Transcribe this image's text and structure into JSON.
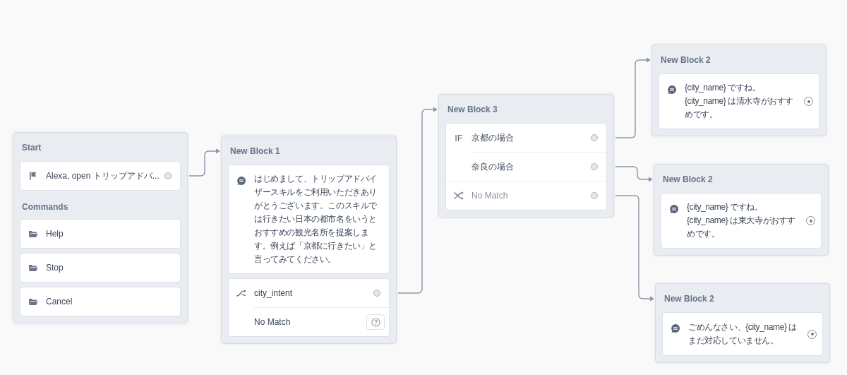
{
  "blocks": [
    {
      "title": "Start",
      "sections": [
        {
          "cards": [
            {
              "rows": [
                {
                  "kind": "trigger",
                  "text": "Alexa, open トリップアドバ..."
                }
              ]
            }
          ]
        },
        {
          "label": "Commands",
          "cards": [
            {
              "rows": [
                {
                  "kind": "command",
                  "text": "Help"
                }
              ]
            },
            {
              "rows": [
                {
                  "kind": "command",
                  "text": "Stop"
                }
              ]
            },
            {
              "rows": [
                {
                  "kind": "command",
                  "text": "Cancel"
                }
              ]
            }
          ]
        }
      ]
    },
    {
      "title": "New Block 1",
      "sections": [
        {
          "cards": [
            {
              "rows": [
                {
                  "kind": "speech",
                  "text": "はじめまして、トリップアドバイザースキルをご利用いただきありがとうございます。このスキルでは行きたい日本の都市名をいうとおすすめの観光名所を提案します。例えば「京都に行きたい」と言ってみてください。"
                }
              ]
            },
            {
              "rows": [
                {
                  "kind": "intent",
                  "text": "city_intent"
                },
                {
                  "kind": "unhandled",
                  "text": "No Match"
                }
              ]
            }
          ]
        }
      ]
    },
    {
      "title": "New Block 3",
      "sections": [
        {
          "cards": [
            {
              "rows": [
                {
                  "kind": "condition",
                  "prefix": "IF",
                  "text": "京都の場合"
                },
                {
                  "kind": "condition",
                  "text": "奈良の場合"
                },
                {
                  "kind": "fallback",
                  "text": "No Match"
                }
              ]
            }
          ]
        }
      ]
    },
    {
      "title": "New Block 2",
      "sections": [
        {
          "cards": [
            {
              "rows": [
                {
                  "kind": "reply",
                  "text": "{city_name} ですね。\n{city_name} は清水寺がおすすめです。"
                }
              ]
            }
          ]
        }
      ]
    },
    {
      "title": "New Block 2",
      "sections": [
        {
          "cards": [
            {
              "rows": [
                {
                  "kind": "reply",
                  "text": "{city_name} ですね。\n{city_name} は東大寺がおすすめです。"
                }
              ]
            }
          ]
        }
      ]
    },
    {
      "title": "New Block 2",
      "sections": [
        {
          "cards": [
            {
              "rows": [
                {
                  "kind": "reply",
                  "text": "ごめんなさい、{city_name} はまだ対応していません。"
                }
              ]
            }
          ]
        }
      ]
    }
  ]
}
